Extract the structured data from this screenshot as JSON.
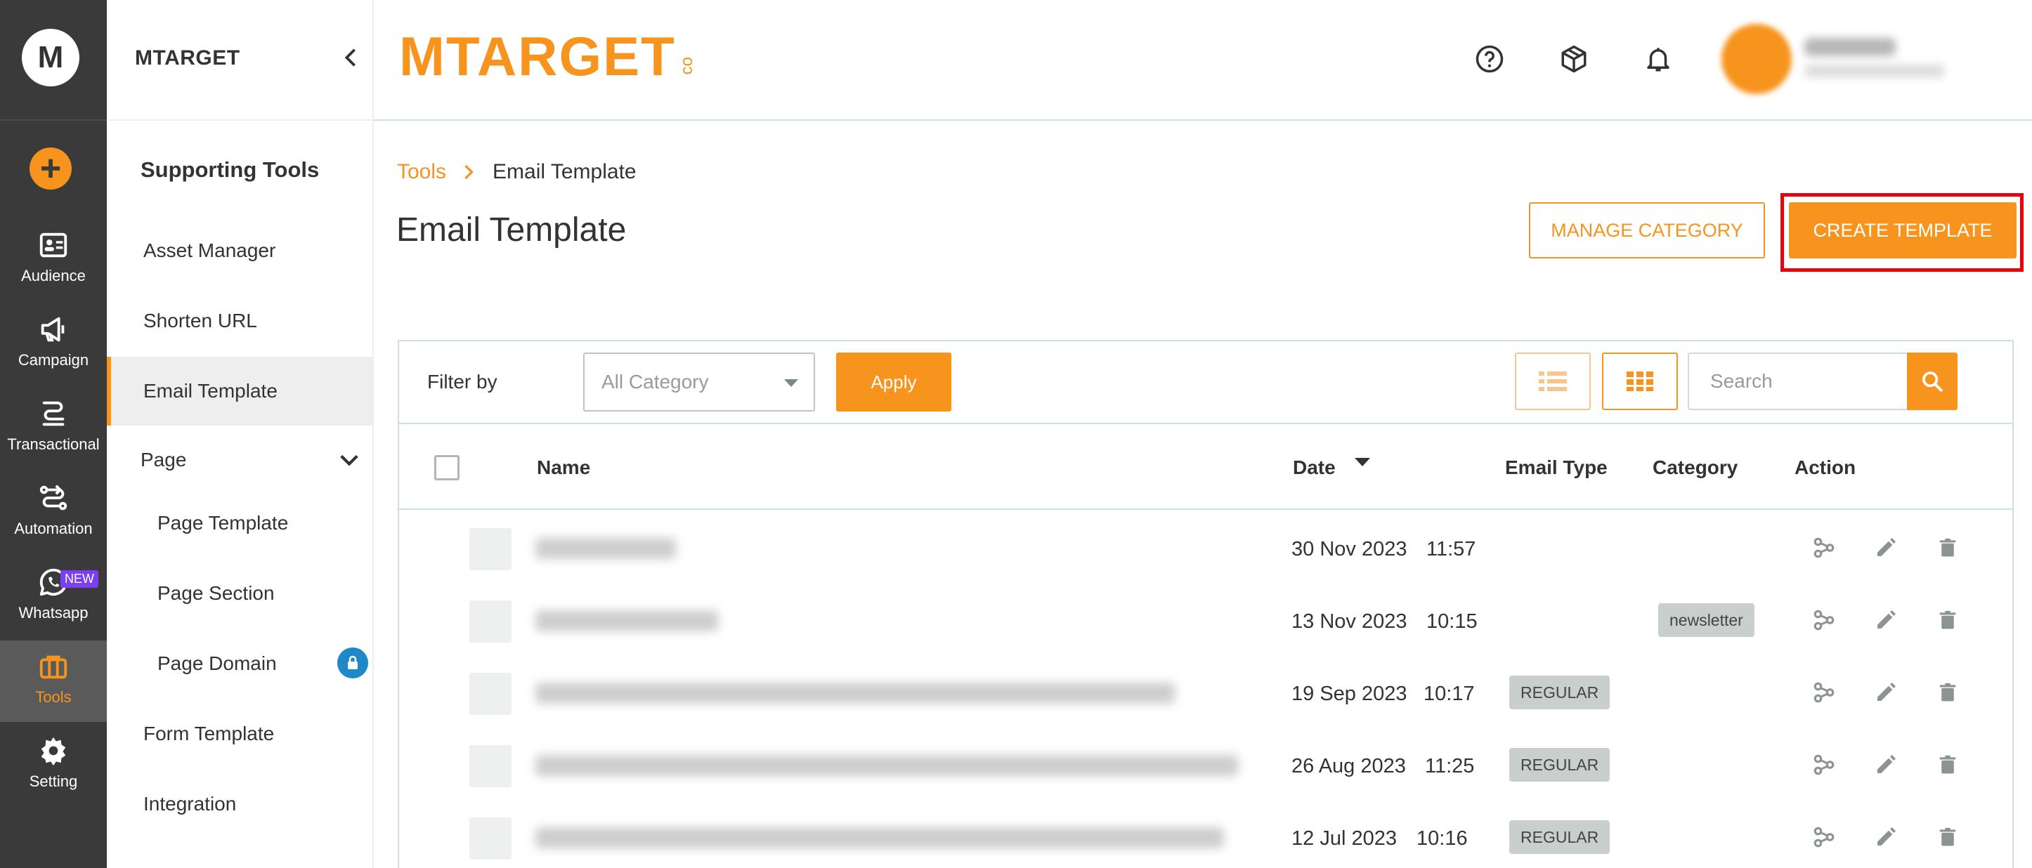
{
  "rail": {
    "logo_letter": "M",
    "add_icon": "plus-circle-icon",
    "items": [
      {
        "label": "Audience",
        "icon": "audience-card-icon"
      },
      {
        "label": "Campaign",
        "icon": "megaphone-icon"
      },
      {
        "label": "Transactional",
        "icon": "transactional-icon"
      },
      {
        "label": "Automation",
        "icon": "automation-icon"
      },
      {
        "label": "Whatsapp",
        "icon": "whatsapp-icon",
        "badge": "NEW"
      },
      {
        "label": "Tools",
        "icon": "toolbox-icon",
        "active": true
      },
      {
        "label": "Setting",
        "icon": "gear-icon"
      }
    ]
  },
  "sidebar": {
    "brand": "MTARGET",
    "section_title": "Supporting Tools",
    "items": [
      {
        "label": "Asset Manager"
      },
      {
        "label": "Shorten URL"
      },
      {
        "label": "Email Template",
        "active": true
      },
      {
        "label": "Page",
        "expandable": true
      },
      {
        "label": "Page Template",
        "sub": true
      },
      {
        "label": "Page Section",
        "sub": true
      },
      {
        "label": "Page Domain",
        "sub": true,
        "locked": true
      },
      {
        "label": "Form Template"
      },
      {
        "label": "Integration"
      }
    ]
  },
  "header": {
    "logo_text": "MTARGET",
    "logo_suffix": "co"
  },
  "breadcrumb": {
    "parent": "Tools",
    "current": "Email Template"
  },
  "page": {
    "title": "Email Template",
    "manage_category_label": "MANAGE CATEGORY",
    "create_template_label": "CREATE TEMPLATE"
  },
  "filter": {
    "label": "Filter by",
    "category_value": "All Category",
    "apply_label": "Apply",
    "search_placeholder": "Search"
  },
  "table": {
    "columns": [
      "Name",
      "Date",
      "Email Type",
      "Category",
      "Action"
    ],
    "rows": [
      {
        "date": "30 Nov 2023",
        "time": "11:57",
        "email_type": "",
        "category": ""
      },
      {
        "date": "13 Nov 2023",
        "time": "10:15",
        "email_type": "",
        "category": "newsletter"
      },
      {
        "date": "19 Sep 2023",
        "time": "10:17",
        "email_type": "REGULAR",
        "category": ""
      },
      {
        "date": "26 Aug 2023",
        "time": "11:25",
        "email_type": "REGULAR",
        "category": ""
      },
      {
        "date": "12 Jul 2023",
        "time": "10:16",
        "email_type": "REGULAR",
        "category": ""
      }
    ]
  },
  "colors": {
    "accent": "#f7941d",
    "rail_bg": "#3a3a3a",
    "highlight": "#e8000b",
    "chip_bg": "#c9cfcc"
  }
}
